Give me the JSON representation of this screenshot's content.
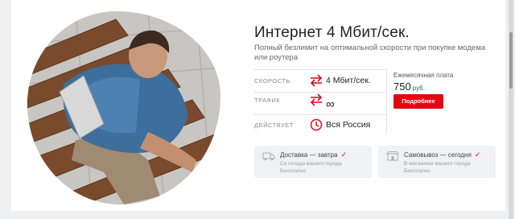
{
  "tariff": {
    "title": "Интернет 4 Мбит/сек.",
    "subtitle": "Полный безлимит на оптимальной скорости при покупке модема или роутера"
  },
  "features": [
    {
      "label": "СКОРОСТЬ",
      "value": "4 Мбит/сек.",
      "icon": "arrows-icon"
    },
    {
      "label": "ТРАФИК",
      "value": "∞",
      "icon": "arrows-icon"
    },
    {
      "label": "ДЕЙСТВУЕТ",
      "value": "Вся Россия",
      "icon": "clock-icon"
    }
  ],
  "price": {
    "label": "Ежемесячная плата",
    "amount": "750",
    "unit": "руб.",
    "button": "Подробнее"
  },
  "delivery": [
    {
      "title": "Доставка — завтра",
      "check": "✓",
      "line1": "Со склада вашего города",
      "line2": "Бесплатно",
      "icon": "truck-icon"
    },
    {
      "title": "Самовывоз — сегодня",
      "check": "✓",
      "line1": "В магазинах вашего города",
      "line2": "Бесплатно",
      "icon": "store-icon"
    }
  ],
  "colors": {
    "accent": "#e30611",
    "text": "#222222",
    "muted": "#888888",
    "panel": "#f0f1f3"
  }
}
